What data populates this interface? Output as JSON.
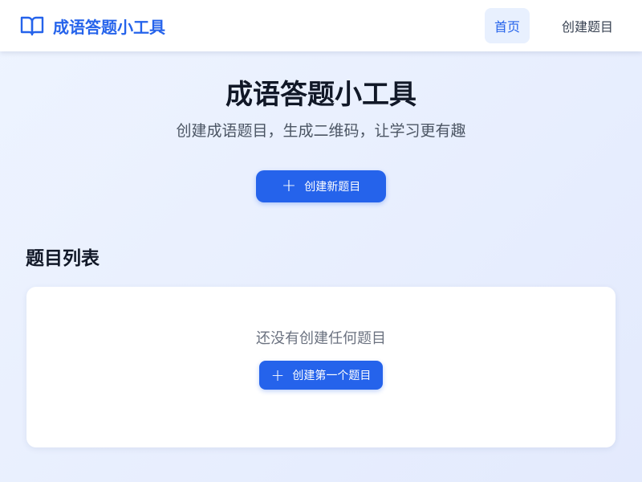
{
  "navbar": {
    "brand_title": "成语答题小工具",
    "brand_icon": "book-open-icon",
    "links": [
      {
        "label": "首页",
        "active": true
      },
      {
        "label": "创建题目",
        "active": false
      }
    ]
  },
  "hero": {
    "title": "成语答题小工具",
    "subtitle": "创建成语题目，生成二维码，让学习更有趣",
    "primary_button_label": "创建新题目",
    "primary_button_icon": "plus-icon"
  },
  "question_list": {
    "title": "题目列表",
    "empty_text": "还没有创建任何题目",
    "empty_button_label": "创建第一个题目",
    "empty_button_icon": "plus-icon"
  },
  "colors": {
    "accent": "#2563eb",
    "nav_active_bg": "#e8f0fe",
    "text_primary": "#111827",
    "text_secondary": "#4b5563",
    "text_muted": "#6b7280"
  }
}
